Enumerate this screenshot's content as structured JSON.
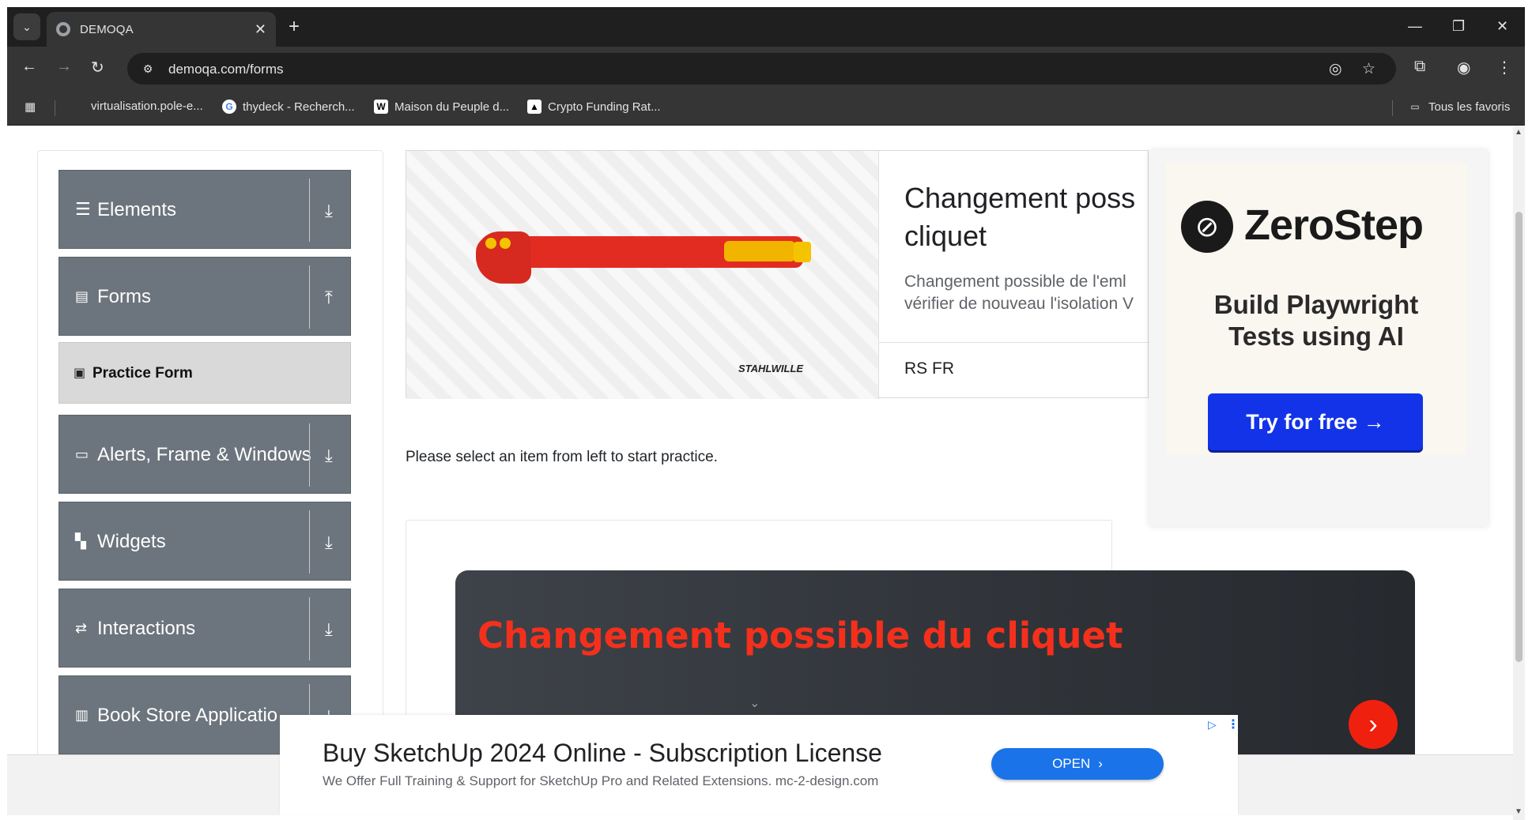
{
  "browser": {
    "tab_title": "DEMOQA",
    "new_tab": "+",
    "url": "demoqa.com/forms",
    "bookmarks": [
      {
        "label": "virtualisation.pole-e..."
      },
      {
        "label": "thydeck - Recherch..."
      },
      {
        "label": "Maison du Peuple d..."
      },
      {
        "label": "Crypto Funding Rat..."
      }
    ],
    "all_bookmarks": "Tous les favoris"
  },
  "sidebar": {
    "groups": [
      {
        "label": "Elements",
        "icon": "hamburger-icon",
        "state": "collapsed"
      },
      {
        "label": "Forms",
        "icon": "document-icon",
        "state": "expanded"
      },
      {
        "label": "Alerts, Frame & Windows",
        "icon": "window-icon",
        "state": "collapsed"
      },
      {
        "label": "Widgets",
        "icon": "widgets-icon",
        "state": "collapsed"
      },
      {
        "label": "Interactions",
        "icon": "interactions-icon",
        "state": "collapsed"
      },
      {
        "label": "Book Store Applicatio",
        "icon": "books-icon",
        "state": "collapsed"
      }
    ],
    "forms_items": [
      {
        "label": "Practice Form",
        "icon": "html5-icon",
        "active": true
      }
    ]
  },
  "ad_card": {
    "brand": "STAHLWILLE",
    "title": "Changement poss cliquet",
    "title_line1": "Changement poss",
    "title_line2": "cliquet",
    "desc_line1": "Changement possible de l'eml",
    "desc_line2": "vérifier de nouveau l'isolation V",
    "source": "RS FR"
  },
  "zerostep_ad": {
    "name": "ZeroStep",
    "tagline_line1": "Build Playwright",
    "tagline_line2": "Tests using AI",
    "cta": "Try for free →"
  },
  "main": {
    "prompt": "Please select an item from left to start practice."
  },
  "video_ad": {
    "title": "Changement possible du cliquet"
  },
  "bottom_ad": {
    "title": "Buy SketchUp 2024 Online - Subscription License",
    "desc": "We Offer Full Training & Support for SketchUp Pro and Related Extensions. mc-2-design.com",
    "cta": "OPEN"
  },
  "colors": {
    "sidebar_group_bg": "#6c757d",
    "active_item_bg": "#d9d9d9",
    "zerostep_cta": "#1233e8",
    "video_title": "#f4301c",
    "open_btn": "#1a73e8"
  }
}
